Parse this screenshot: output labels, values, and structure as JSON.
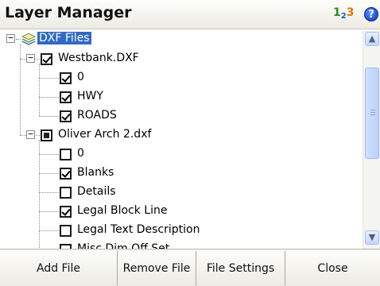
{
  "header": {
    "title": "Layer Manager",
    "ime_label_a": "1",
    "ime_label_b": "2",
    "ime_label_c": "3",
    "help_glyph": "?"
  },
  "tree": {
    "root_label": "DXF Files",
    "files": [
      {
        "label": "Westbank.DXF",
        "state": "checked",
        "layers": [
          {
            "label": "0",
            "checked": true
          },
          {
            "label": "HWY",
            "checked": true
          },
          {
            "label": "ROADS",
            "checked": true
          }
        ]
      },
      {
        "label": "Oliver Arch 2.dxf",
        "state": "partial",
        "layers": [
          {
            "label": "0",
            "checked": false
          },
          {
            "label": "Blanks",
            "checked": true
          },
          {
            "label": "Details",
            "checked": false
          },
          {
            "label": "Legal Block Line",
            "checked": true
          },
          {
            "label": "Legal Text Description",
            "checked": false
          },
          {
            "label": "Misc Dim Off Set",
            "checked": false
          }
        ]
      }
    ]
  },
  "scrollbar": {
    "up_glyph": "▲",
    "down_glyph": "▼"
  },
  "buttons": {
    "add_file": "Add File",
    "remove_file": "Remove File",
    "file_settings": "File Settings",
    "close": "Close"
  },
  "colors": {
    "selection": "#316ac5",
    "scroll_accent": "#c4d6fb"
  },
  "icons": {
    "root": "layers-icon",
    "help": "help-icon"
  }
}
